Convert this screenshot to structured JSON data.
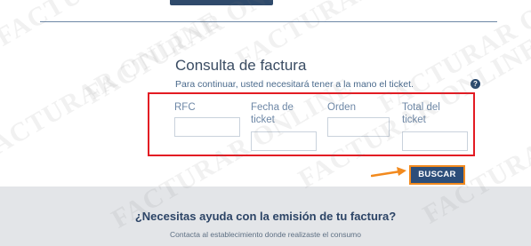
{
  "watermark": "FACTURAR ONLINE",
  "form": {
    "title": "Consulta de factura",
    "subtitle": "Para continuar, usted necesitará tener a la mano el ticket.",
    "help_icon": "?",
    "fields": {
      "rfc": "RFC",
      "fecha": "Fecha de ticket",
      "orden": "Orden",
      "total": "Total del ticket"
    },
    "submit_label": "BUSCAR"
  },
  "footer": {
    "title": "¿Necesitas ayuda con la emisión de tu factura?",
    "text": "Contacta al establecimiento donde realizaste el consumo"
  },
  "colors": {
    "accent": "#2c4e7a",
    "highlight_box": "#e31b23",
    "arrow": "#f28a1e"
  }
}
